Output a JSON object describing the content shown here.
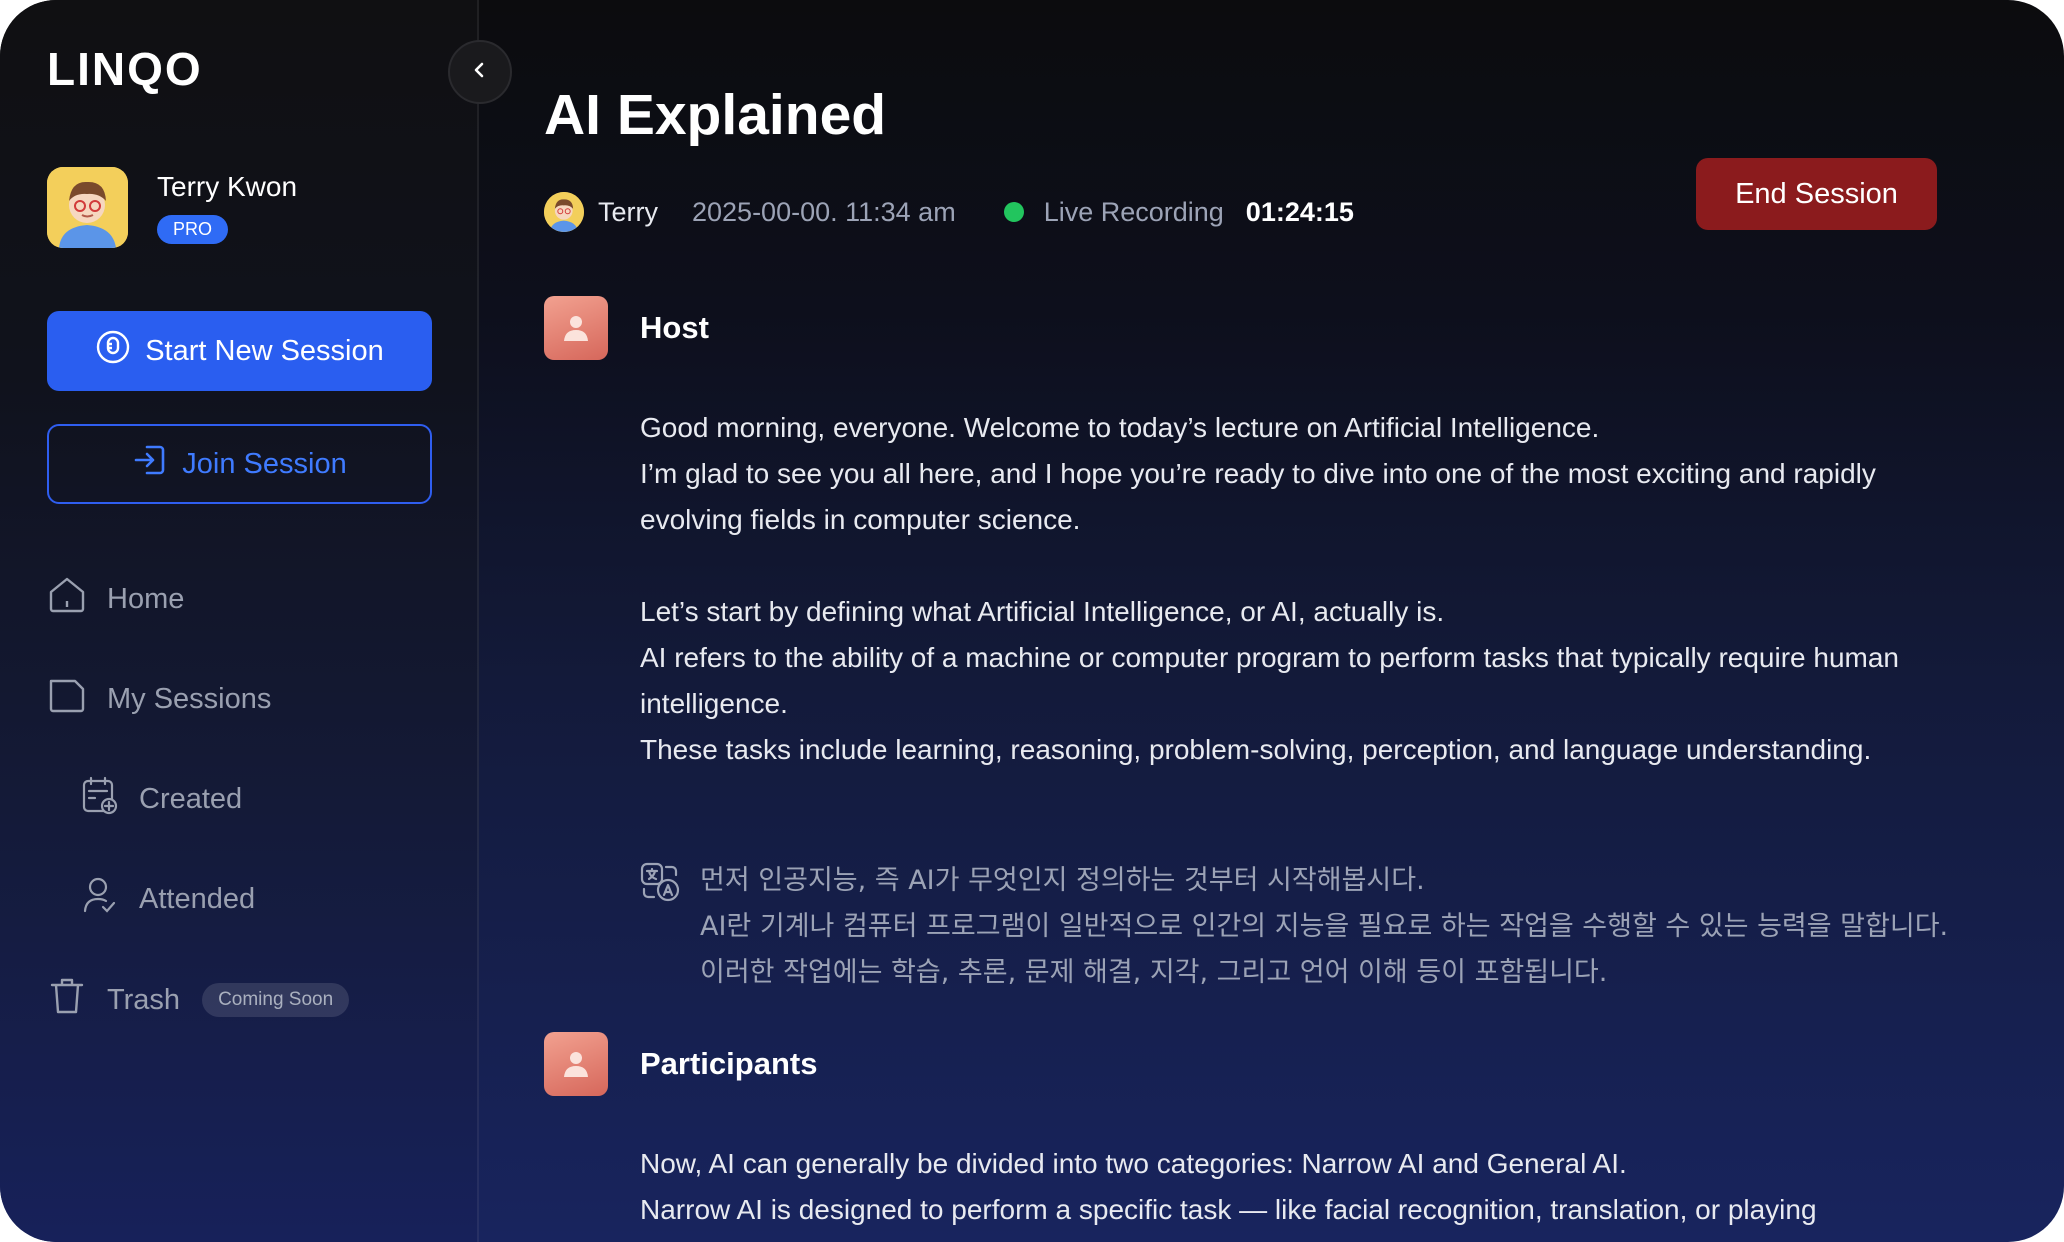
{
  "app": {
    "logo": "LINQO"
  },
  "profile": {
    "name": "Terry Kwon",
    "badge": "PRO"
  },
  "actions": {
    "start_label": "Start New Session",
    "join_label": "Join Session"
  },
  "nav": {
    "home": "Home",
    "my_sessions": "My Sessions",
    "created": "Created",
    "attended": "Attended",
    "trash": "Trash",
    "trash_badge": "Coming Soon"
  },
  "session": {
    "title": "AI Explained",
    "host_name": "Terry",
    "datetime": "2025-00-00. 11:34 am",
    "status": "Live Recording",
    "timer": "01:24:15",
    "end_label": "End Session"
  },
  "transcript": {
    "host_label": "Host",
    "host_lines": [
      "Good morning, everyone. Welcome to today’s lecture on Artificial Intelligence.",
      "I’m glad to see you all here, and I hope you’re ready to dive into one of the most exciting and rapidly evolving fields in computer science.",
      "Let’s start by defining what Artificial Intelligence, or AI, actually is.",
      "AI refers to the ability of a machine or computer program to perform tasks that typically require human intelligence.",
      "These tasks include learning, reasoning, problem-solving, perception, and language understanding."
    ],
    "translation_lines": [
      "먼저 인공지능, 즉 AI가 무엇인지 정의하는 것부터 시작해봅시다.",
      "AI란 기계나 컴퓨터 프로그램이 일반적으로 인간의 지능을 필요로 하는 작업을 수행할 수 있는 능력을 말합니다. 이러한 작업에는 학습, 추론, 문제 해결, 지각, 그리고 언어 이해 등이 포함됩니다."
    ],
    "participants_label": "Participants",
    "participant_lines": [
      "Now, AI can generally be divided into two categories: Narrow AI and General AI.",
      "Narrow AI is designed to perform a specific task — like facial recognition, translation, or playing"
    ]
  },
  "colors": {
    "accent": "#2a5ef0",
    "danger": "#8b1b1d",
    "live": "#22c55e",
    "speaker_icon": "#e07c6c"
  }
}
